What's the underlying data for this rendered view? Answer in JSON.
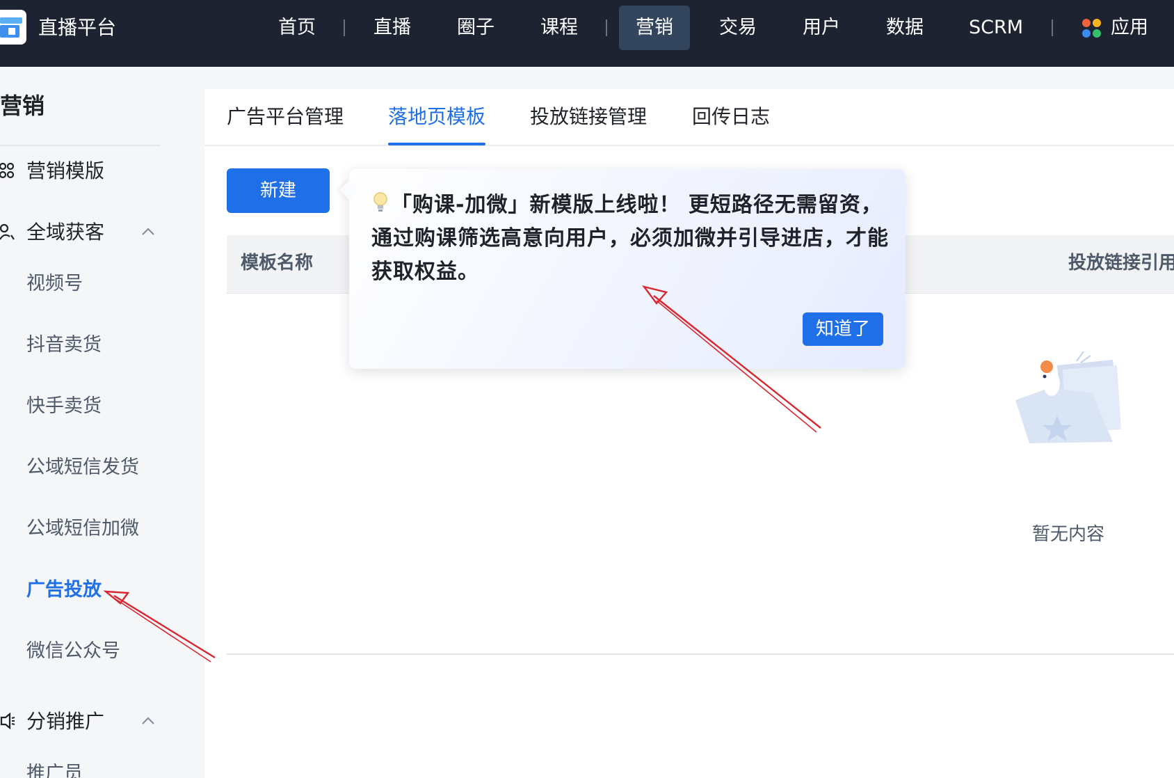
{
  "app": {
    "brand": "直播平台",
    "nav": [
      {
        "label": "首页"
      },
      {
        "label": "直播"
      },
      {
        "label": "圈子"
      },
      {
        "label": "课程"
      },
      {
        "label": "营销",
        "active": true
      },
      {
        "label": "交易"
      },
      {
        "label": "用户"
      },
      {
        "label": "数据"
      },
      {
        "label": "SCRM"
      },
      {
        "label": "应用"
      }
    ]
  },
  "sidebar": {
    "title": "营销",
    "groups": [
      {
        "label": "营销模版",
        "icon": "grid-icon"
      },
      {
        "label": "全域获客",
        "icon": "user-scan-icon",
        "expanded": true,
        "items": [
          "视频号",
          "抖音卖货",
          "快手卖货",
          "公域短信发货",
          "公域短信加微",
          "广告投放",
          "微信公众号"
        ]
      },
      {
        "label": "分销推广",
        "icon": "megaphone-icon",
        "expanded": true,
        "items": [
          "推广员"
        ]
      }
    ],
    "active_item": "广告投放"
  },
  "content": {
    "tabs": [
      "广告平台管理",
      "落地页模板",
      "投放链接管理",
      "回传日志"
    ],
    "active_tab": "落地页模板",
    "new_button": "新建",
    "columns": [
      "模板名称",
      "投放链接引用数"
    ],
    "empty_text": "暂无内容"
  },
  "popover": {
    "message": "「购课-加微」新模版上线啦！ 更短路径无需留资，通过购课筛选高意向用户，必须加微并引导进店，才能获取权益。",
    "confirm": "知道了"
  },
  "colors": {
    "topbar": "#1d2331",
    "nav_active": "#34465e",
    "primary": "#1f6fe8",
    "annotation_arrow": "#d9262e"
  }
}
